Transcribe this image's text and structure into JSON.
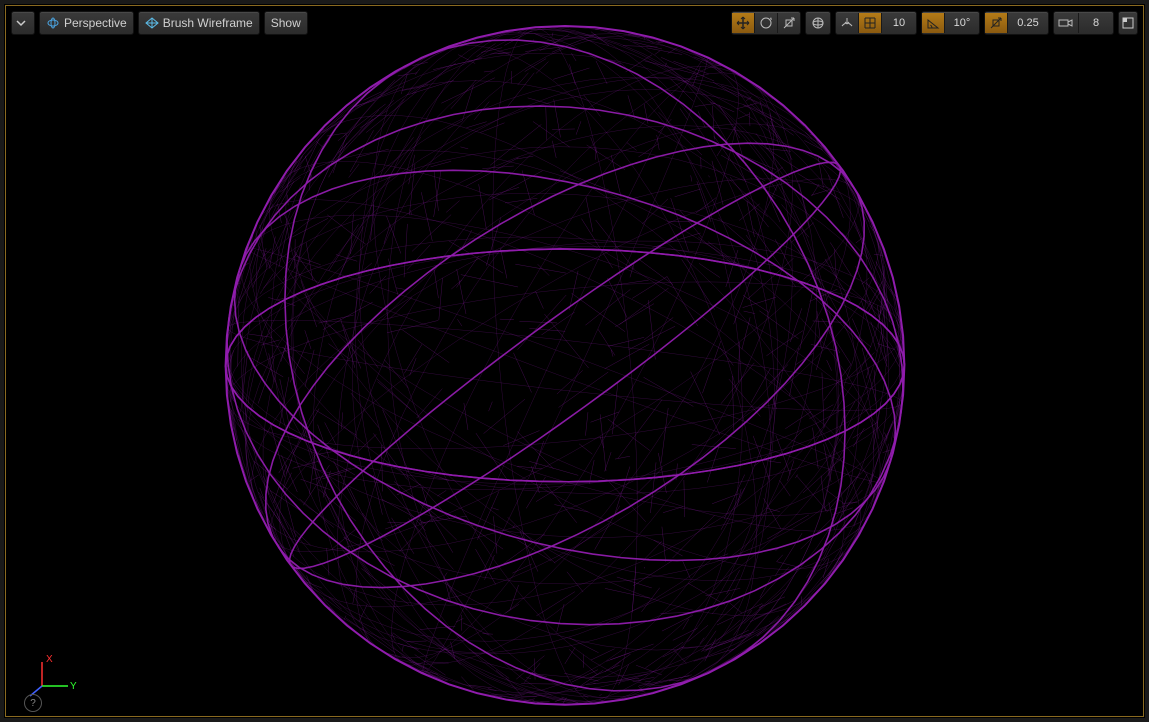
{
  "toolbar": {
    "perspective_label": "Perspective",
    "viewmode_label": "Brush Wireframe",
    "show_label": "Show",
    "grid_snap_value": "10",
    "angle_snap_value": "10°",
    "scale_snap_value": "0.25",
    "camera_speed_value": "8"
  },
  "axes": {
    "x": "X",
    "y": "Y",
    "z": ""
  },
  "help": "?",
  "colors": {
    "wire": "#a020c0",
    "orange": "#d88a1c"
  }
}
